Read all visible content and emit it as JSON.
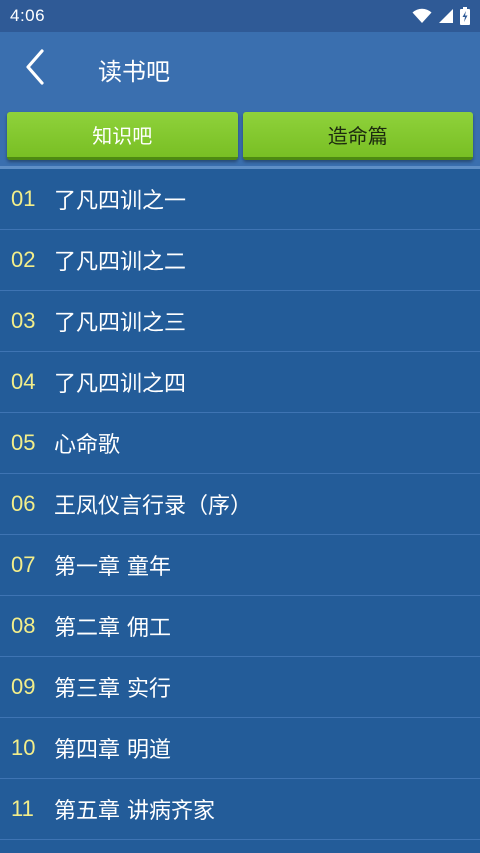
{
  "status_bar": {
    "time": "4:06",
    "icons": [
      "wifi-icon",
      "cell-signal-icon",
      "battery-charging-icon"
    ]
  },
  "app_bar": {
    "back_icon": "chevron-left-icon",
    "title": "读书吧"
  },
  "tabs": [
    {
      "label": "知识吧",
      "selected": true
    },
    {
      "label": "造命篇",
      "selected": false
    }
  ],
  "colors": {
    "background": "#235C99",
    "app_bar": "#3A6FAF",
    "tab_green": "#86C931",
    "number_yellow": "#F3EE8A"
  },
  "list": [
    {
      "num": "01",
      "title": "了凡四训之一"
    },
    {
      "num": "02",
      "title": "了凡四训之二"
    },
    {
      "num": "03",
      "title": "了凡四训之三"
    },
    {
      "num": "04",
      "title": "了凡四训之四"
    },
    {
      "num": "05",
      "title": "心命歌"
    },
    {
      "num": "06",
      "title": "王凤仪言行录（序）"
    },
    {
      "num": "07",
      "title": "第一章 童年"
    },
    {
      "num": "08",
      "title": "第二章 佣工"
    },
    {
      "num": "09",
      "title": "第三章 实行"
    },
    {
      "num": "10",
      "title": "第四章 明道"
    },
    {
      "num": "11",
      "title": "第五章 讲病齐家"
    }
  ]
}
